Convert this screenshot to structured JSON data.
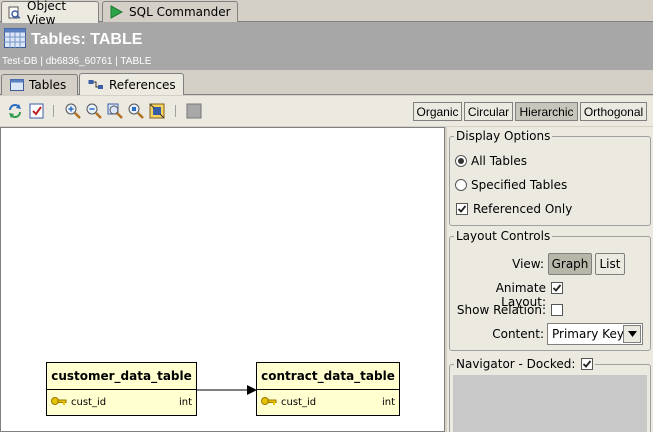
{
  "top_tabs": [
    {
      "label": "Object View",
      "active": true
    },
    {
      "label": "SQL Commander",
      "active": false
    }
  ],
  "header": {
    "title": "Tables: TABLE",
    "meta": "Test-DB  |  db6836_60761  |  TABLE"
  },
  "sub_tabs": [
    {
      "label": "Tables",
      "active": false
    },
    {
      "label": "References",
      "active": true
    }
  ],
  "toolbar": {
    "icons": [
      "refresh-icon",
      "select-icon",
      "zoom-in-icon",
      "zoom-out-icon",
      "zoom-fit-icon",
      "zoom-area-icon",
      "fit-page-icon",
      "stop-icon"
    ],
    "layouts": [
      {
        "label": "Organic",
        "active": false
      },
      {
        "label": "Circular",
        "active": false
      },
      {
        "label": "Hierarchic",
        "active": true
      },
      {
        "label": "Orthogonal",
        "active": false
      }
    ]
  },
  "diagram": {
    "tables": [
      {
        "name": "customer_data_table",
        "columns": [
          {
            "name": "cust_id",
            "type": "int",
            "key": true
          }
        ]
      },
      {
        "name": "contract_data_table",
        "columns": [
          {
            "name": "cust_id",
            "type": "int",
            "key": true
          }
        ]
      }
    ]
  },
  "display_options": {
    "title": "Display Options",
    "all_tables": "All Tables",
    "specified_tables": "Specified Tables",
    "referenced_only": "Referenced Only",
    "selected_radio": "all_tables",
    "referenced_only_checked": true
  },
  "layout_controls": {
    "title": "Layout Controls",
    "view_label": "View:",
    "view_graph": "Graph",
    "view_list": "List",
    "view_selected": "graph",
    "animate_label": "Animate Layout:",
    "animate_checked": true,
    "show_relation_label": "Show Relation:",
    "show_relation_checked": false,
    "content_label": "Content:",
    "content_value": "Primary Key"
  },
  "navigator": {
    "title": "Navigator - Docked:",
    "checked": true
  },
  "colors": {
    "header_bg": "#a7a7a7",
    "table_fill": "#ffffd0",
    "panel_bg": "#ece9e1"
  }
}
